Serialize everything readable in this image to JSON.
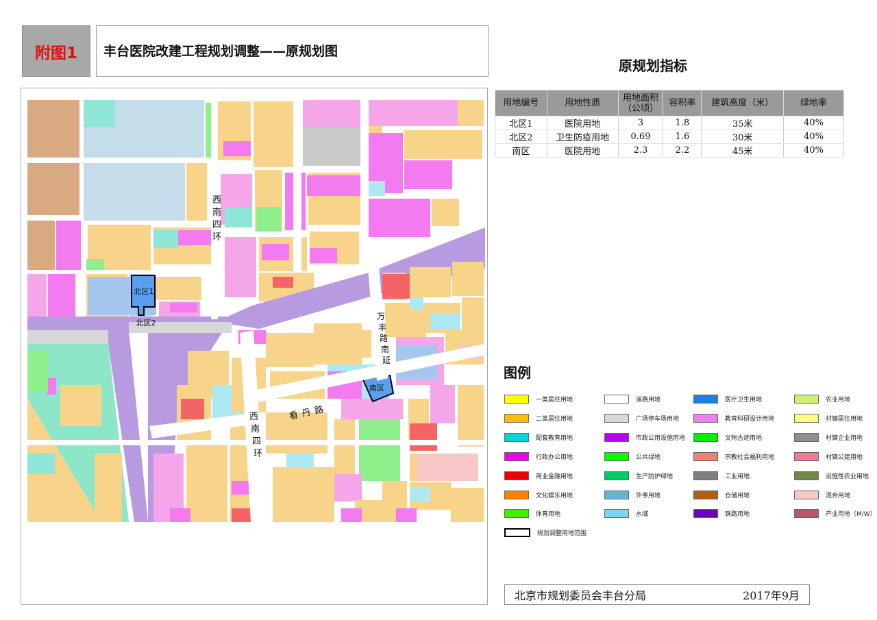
{
  "header": {
    "figure_tag": "附图1",
    "title": "丰台医院改建工程规划调整——原规划图"
  },
  "indicators": {
    "title": "原规划指标",
    "columns": [
      "用地编号",
      "用地性质",
      "用地面积\n（公顷）",
      "容积率",
      "建筑高度（米）",
      "绿地率"
    ],
    "rows": [
      [
        "北区1",
        "医院用地",
        "3",
        "1.8",
        "35米",
        "40%"
      ],
      [
        "北区2",
        "卫生防疫用地",
        "0.69",
        "1.6",
        "30米",
        "40%"
      ],
      [
        "南区",
        "医院用地",
        "2.3",
        "2.2",
        "45米",
        "40%"
      ]
    ]
  },
  "map": {
    "labels": {
      "north1": "北区1",
      "north2": "北区2",
      "south": "南区",
      "road_xinan_top": "西南四环",
      "road_xinan_bottom": "西南四环",
      "road_wanfeng": "万丰路南延",
      "road_kandan": "看丹路"
    },
    "colors": {
      "residential2": "#f8d48a",
      "education_facility": "#f47af0",
      "medical": "#5a9ef0",
      "road": "#ffffff",
      "river": "#b79ae0",
      "green_belt": "#8ee6c8",
      "public_green": "#8ef08a",
      "admin_office": "#f5a6e8",
      "commerce": "#f46464",
      "square_parking": "#d7d7d7",
      "water": "#aee8f2",
      "bg_brown": "#d9aa82",
      "light_blue": "#c5dcea"
    }
  },
  "legend": {
    "title": "图例",
    "items": [
      {
        "label": "一类居住用地",
        "color": "#ffff00"
      },
      {
        "label": "二类居住用地",
        "color": "#ffbf00"
      },
      {
        "label": "配套教育用地",
        "color": "#00d7d7"
      },
      {
        "label": "行政办公用地",
        "color": "#ee00ee"
      },
      {
        "label": "商业金融用地",
        "color": "#ee0000"
      },
      {
        "label": "文化娱乐用地",
        "color": "#ff7f00"
      },
      {
        "label": "体育用地",
        "color": "#44ee00"
      },
      {
        "label": "道路用地",
        "color": "#ffffff"
      },
      {
        "label": "广场停车场用地",
        "color": "#d9d9d9"
      },
      {
        "label": "市政公用设施用地",
        "color": "#bb00ee"
      },
      {
        "label": "公共绿地",
        "color": "#00ff00"
      },
      {
        "label": "生产防护绿地",
        "color": "#00cc66"
      },
      {
        "label": "外事用地",
        "color": "#66b3d9"
      },
      {
        "label": "水域",
        "color": "#7fd4f2"
      },
      {
        "label": "医疗卫生用地",
        "color": "#1e7fe8"
      },
      {
        "label": "教育科研设计用地",
        "color": "#f07ff0"
      },
      {
        "label": "文物古迹用地",
        "color": "#00ee00"
      },
      {
        "label": "宗教社会福利用地",
        "color": "#f08070"
      },
      {
        "label": "工业用地",
        "color": "#808080"
      },
      {
        "label": "仓储用地",
        "color": "#b25f0f"
      },
      {
        "label": "铁路用地",
        "color": "#6b00bb"
      },
      {
        "label": "农业用地",
        "color": "#ccf070"
      },
      {
        "label": "村镇居住用地",
        "color": "#ffff80"
      },
      {
        "label": "村镇企业用地",
        "color": "#8e8e8e"
      },
      {
        "label": "村镇公建用地",
        "color": "#f07d95"
      },
      {
        "label": "设施性农业用地",
        "color": "#6e8a46"
      },
      {
        "label": "混合用地",
        "color": "#f7c6c6"
      },
      {
        "label": "产业用地（M/W）",
        "color": "#b25a70"
      }
    ],
    "scope_label": "规划调整用地范围"
  },
  "footer": {
    "agency": "北京市规划委员会丰台分局",
    "date": "2017年9月"
  }
}
